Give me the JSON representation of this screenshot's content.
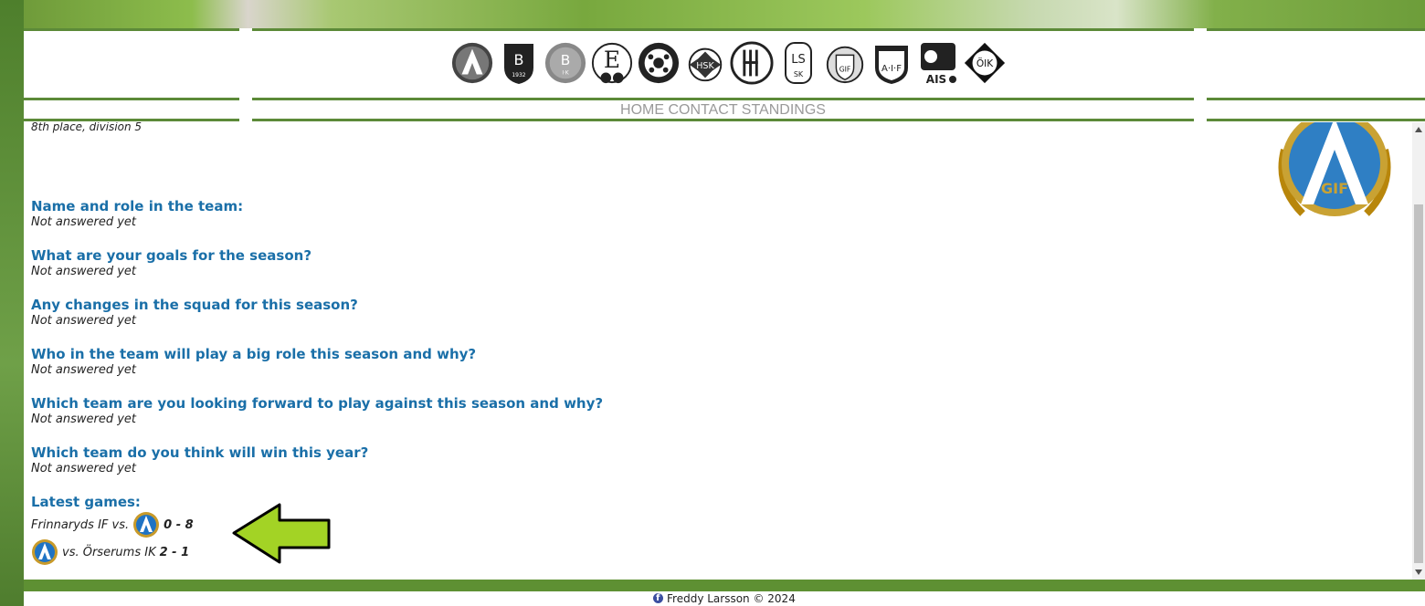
{
  "nav": {
    "items": [
      "HOME",
      "CONTACT",
      "STANDINGS"
    ]
  },
  "club_logos": [
    "agif-logo",
    "bif-1932-logo",
    "bik-logo",
    "eif-logo",
    "eksjo-ff-logo",
    "hsk-1967-logo",
    "hgif-logo",
    "lssk-logo",
    "solberga-gif-logo",
    "aif-logo",
    "torpa-ais-logo",
    "oik-logo"
  ],
  "team": {
    "placement": "8th place, division 5"
  },
  "questions": [
    {
      "q": "Name and role in the team:",
      "a": "Not answered yet"
    },
    {
      "q": "What are your goals for the season?",
      "a": "Not answered yet"
    },
    {
      "q": "Any changes in the squad for this season?",
      "a": "Not answered yet"
    },
    {
      "q": "Who in the team will play a big role this season and why?",
      "a": "Not answered yet"
    },
    {
      "q": "Which team are you looking forward to play against this season and why?",
      "a": "Not answered yet"
    },
    {
      "q": "Which team do you think will win this year?",
      "a": "Not answered yet"
    }
  ],
  "latest_games": {
    "title": "Latest games:",
    "games": [
      {
        "text": "Frinnaryds IF vs.",
        "score": "0 - 8"
      },
      {
        "text": "vs. Örserums IK",
        "score": "2 - 1"
      }
    ]
  },
  "big_logo_text": "GIF",
  "footer": {
    "text": "Freddy Larsson © 2024"
  },
  "colors": {
    "accent_green": "#5c8a38",
    "question_blue": "#1a6fa8",
    "arrow_green": "#a3d325"
  }
}
